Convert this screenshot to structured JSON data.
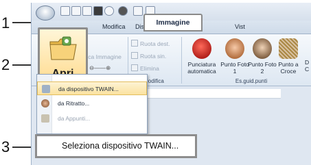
{
  "callouts": {
    "one": "1",
    "two": "2",
    "three": "3"
  },
  "tabs": {
    "modifica": "Modifica",
    "disposizione": "Disposizione",
    "immagine": "Immagine",
    "visualizza": "Vist"
  },
  "ribbon": {
    "modifica_immagine": "fica Immagine",
    "ruota_dest": "Ruota dest.",
    "ruota_sin": "Ruota sin.",
    "elimina": "Elimina",
    "group_modifica": "Modifica",
    "group_esguid": "Es.guid.punti",
    "punciatura_automatica": "Punciatura automatica",
    "punto_foto1": "Punto Foto 1",
    "punto_foto2": "Punto Foto 2",
    "punto_croce": "Punto a Croce",
    "trailing_d": "D",
    "trailing_c": "C"
  },
  "apri": {
    "label": "Apri"
  },
  "menu": {
    "items": [
      {
        "label": "da dispositivo TWAIN...",
        "disabled": false
      },
      {
        "label": "da Ritratto...",
        "disabled": false
      },
      {
        "label": "da Appunti...",
        "disabled": true
      }
    ]
  },
  "select_twain": {
    "label": "Seleziona dispositivo TWAIN..."
  },
  "colors": {
    "ribbon_bg": "#dde7f2",
    "apri_bg": "#ffd98a",
    "highlight_border": "#8d8d8d"
  }
}
